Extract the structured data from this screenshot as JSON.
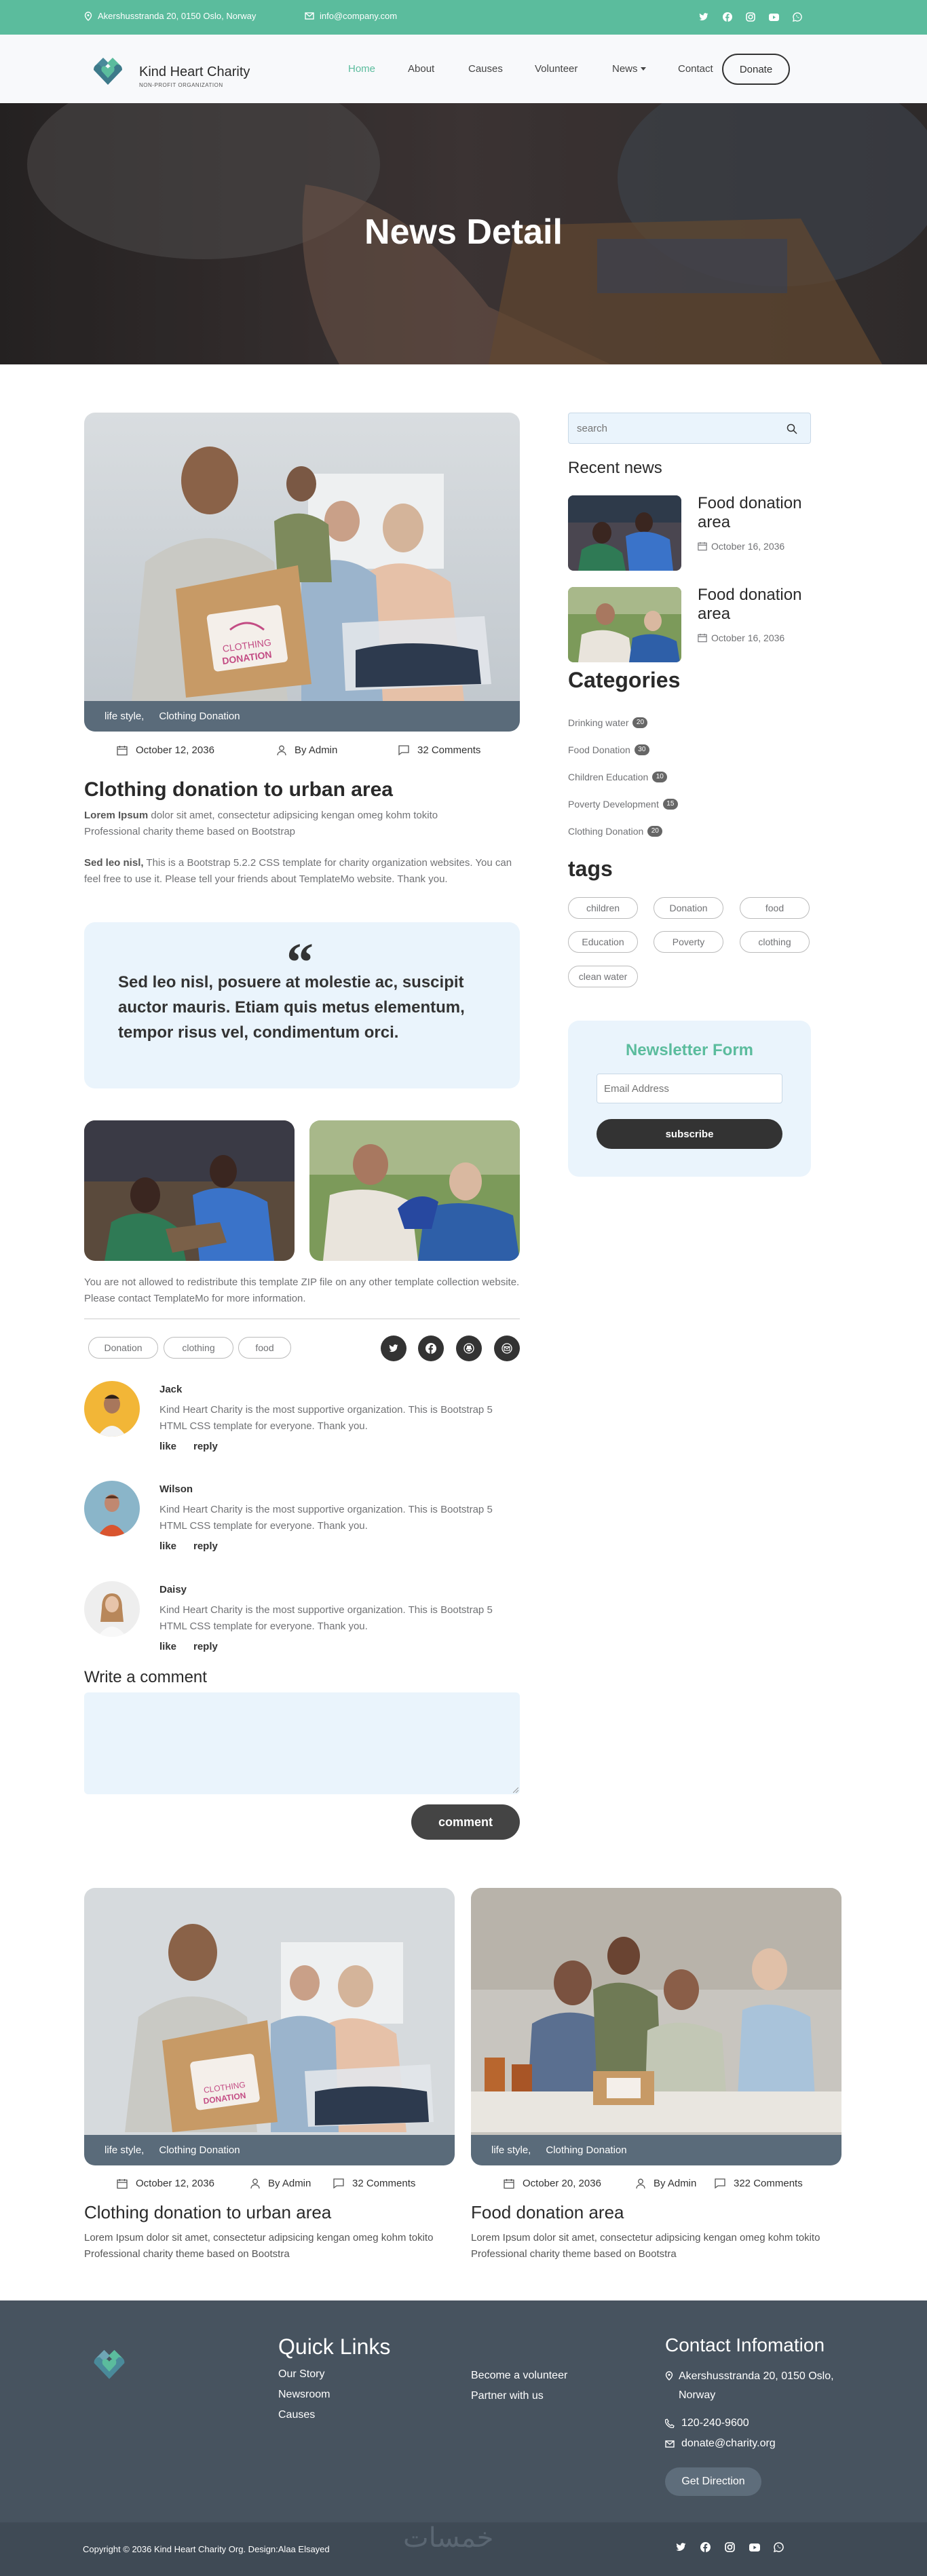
{
  "topbar": {
    "address": "Akershusstranda 20, 0150 Oslo, Norway",
    "email": "info@company.com",
    "social_icons": [
      "twitter-icon",
      "facebook-icon",
      "instagram-icon",
      "youtube-icon",
      "whatsapp-icon"
    ]
  },
  "brand": {
    "name": "Kind Heart Charity",
    "tagline": "NON-PROFIT ORGANIZATION"
  },
  "nav": {
    "items": [
      "Home",
      "About",
      "Causes",
      "Volunteer",
      "News",
      "Contact"
    ],
    "active": "Home",
    "donate": "Donate"
  },
  "hero": {
    "title": "News Detail"
  },
  "article": {
    "tags": [
      "life style,",
      "Clothing Donation"
    ],
    "date": "October 12, 2036",
    "author": "By Admin",
    "comments": "32 Comments",
    "title": "Clothing donation to urban area",
    "lead_bold": "Lorem Ipsum",
    "lead_text": " dolor sit amet, consectetur adipsicing kengan omeg kohm tokito Professional charity theme based on Bootstrap",
    "p2_bold": "Sed leo nisl,",
    "p2_text": " This is a Bootstrap 5.2.2 CSS template for charity organization websites. You can feel free to use it. Please tell your friends about TemplateMo website. Thank you.",
    "quote": "Sed leo nisl, posuere at molestie ac, suscipit auctor mauris. Etiam quis metus elementum, tempor risus vel, condimentum orci.",
    "note": "You are not allowed to redistribute this template ZIP file on any other template collection website. Please contact TemplateMo for more information.",
    "bottom_tags": [
      "Donation",
      "clothing",
      "food"
    ]
  },
  "comments": [
    {
      "name": "Jack",
      "text": "Kind Heart Charity is the most supportive organization. This is Bootstrap 5 HTML CSS template for everyone. Thank you.",
      "like": "like",
      "reply": "reply"
    },
    {
      "name": "Wilson",
      "text": "Kind Heart Charity is the most supportive organization. This is Bootstrap 5 HTML CSS template for everyone. Thank you.",
      "like": "like",
      "reply": "reply"
    },
    {
      "name": "Daisy",
      "text": "Kind Heart Charity is the most supportive organization. This is Bootstrap 5 HTML CSS template for everyone. Thank you.",
      "like": "like",
      "reply": "reply"
    }
  ],
  "comment_form": {
    "title": "Write a comment",
    "button": "comment"
  },
  "sidebar": {
    "search_placeholder": "search",
    "recent_title": "Recent news",
    "recent": [
      {
        "title": "Food donation area",
        "date": "October 16, 2036"
      },
      {
        "title": "Food donation area",
        "date": "October 16, 2036"
      }
    ],
    "categories_title": "Categories",
    "categories": [
      {
        "label": "Drinking water",
        "count": "20"
      },
      {
        "label": "Food Donation",
        "count": "30"
      },
      {
        "label": "Children Education",
        "count": "10"
      },
      {
        "label": "Poverty Development",
        "count": "15"
      },
      {
        "label": "Clothing Donation",
        "count": "20"
      }
    ],
    "tags_title": "tags",
    "tags": [
      "children",
      "Donation",
      "food",
      "Education",
      "Poverty",
      "clothing",
      "clean water"
    ],
    "newsletter_title": "Newsletter Form",
    "newsletter_placeholder": "Email Address",
    "newsletter_button": "subscribe"
  },
  "related": [
    {
      "tags": [
        "life style,",
        "Clothing Donation"
      ],
      "date": "October 12, 2036",
      "author": "By Admin",
      "comments": "32 Comments",
      "title": "Clothing donation to urban area",
      "text": "Lorem Ipsum dolor sit amet, consectetur adipsicing kengan omeg kohm tokito Professional charity theme based on Bootstra"
    },
    {
      "tags": [
        "life style,",
        "Clothing Donation"
      ],
      "date": "October 20, 2036",
      "author": "By Admin",
      "comments": "322 Comments",
      "title": "Food donation area",
      "text": "Lorem Ipsum dolor sit amet, consectetur adipsicing kengan omeg kohm tokito Professional charity theme based on Bootstra"
    }
  ],
  "footer": {
    "quick_title": "Quick Links",
    "links_col1": [
      "Our Story",
      "Newsroom",
      "Causes"
    ],
    "links_col2": [
      "Become a volunteer",
      "Partner with us"
    ],
    "contact_title": "Contact Infomation",
    "address": "Akershusstranda 20, 0150 Oslo, Norway",
    "phone": "120-240-9600",
    "email": "donate@charity.org",
    "direction": "Get Direction",
    "copyright": "Copyright © 2036 Kind Heart Charity Org. Design:Alaa Elsayed",
    "watermark": "خمسات"
  },
  "colors": {
    "accent": "#5bbc9d",
    "dark": "#47535f",
    "light": "#eaf4fc"
  }
}
